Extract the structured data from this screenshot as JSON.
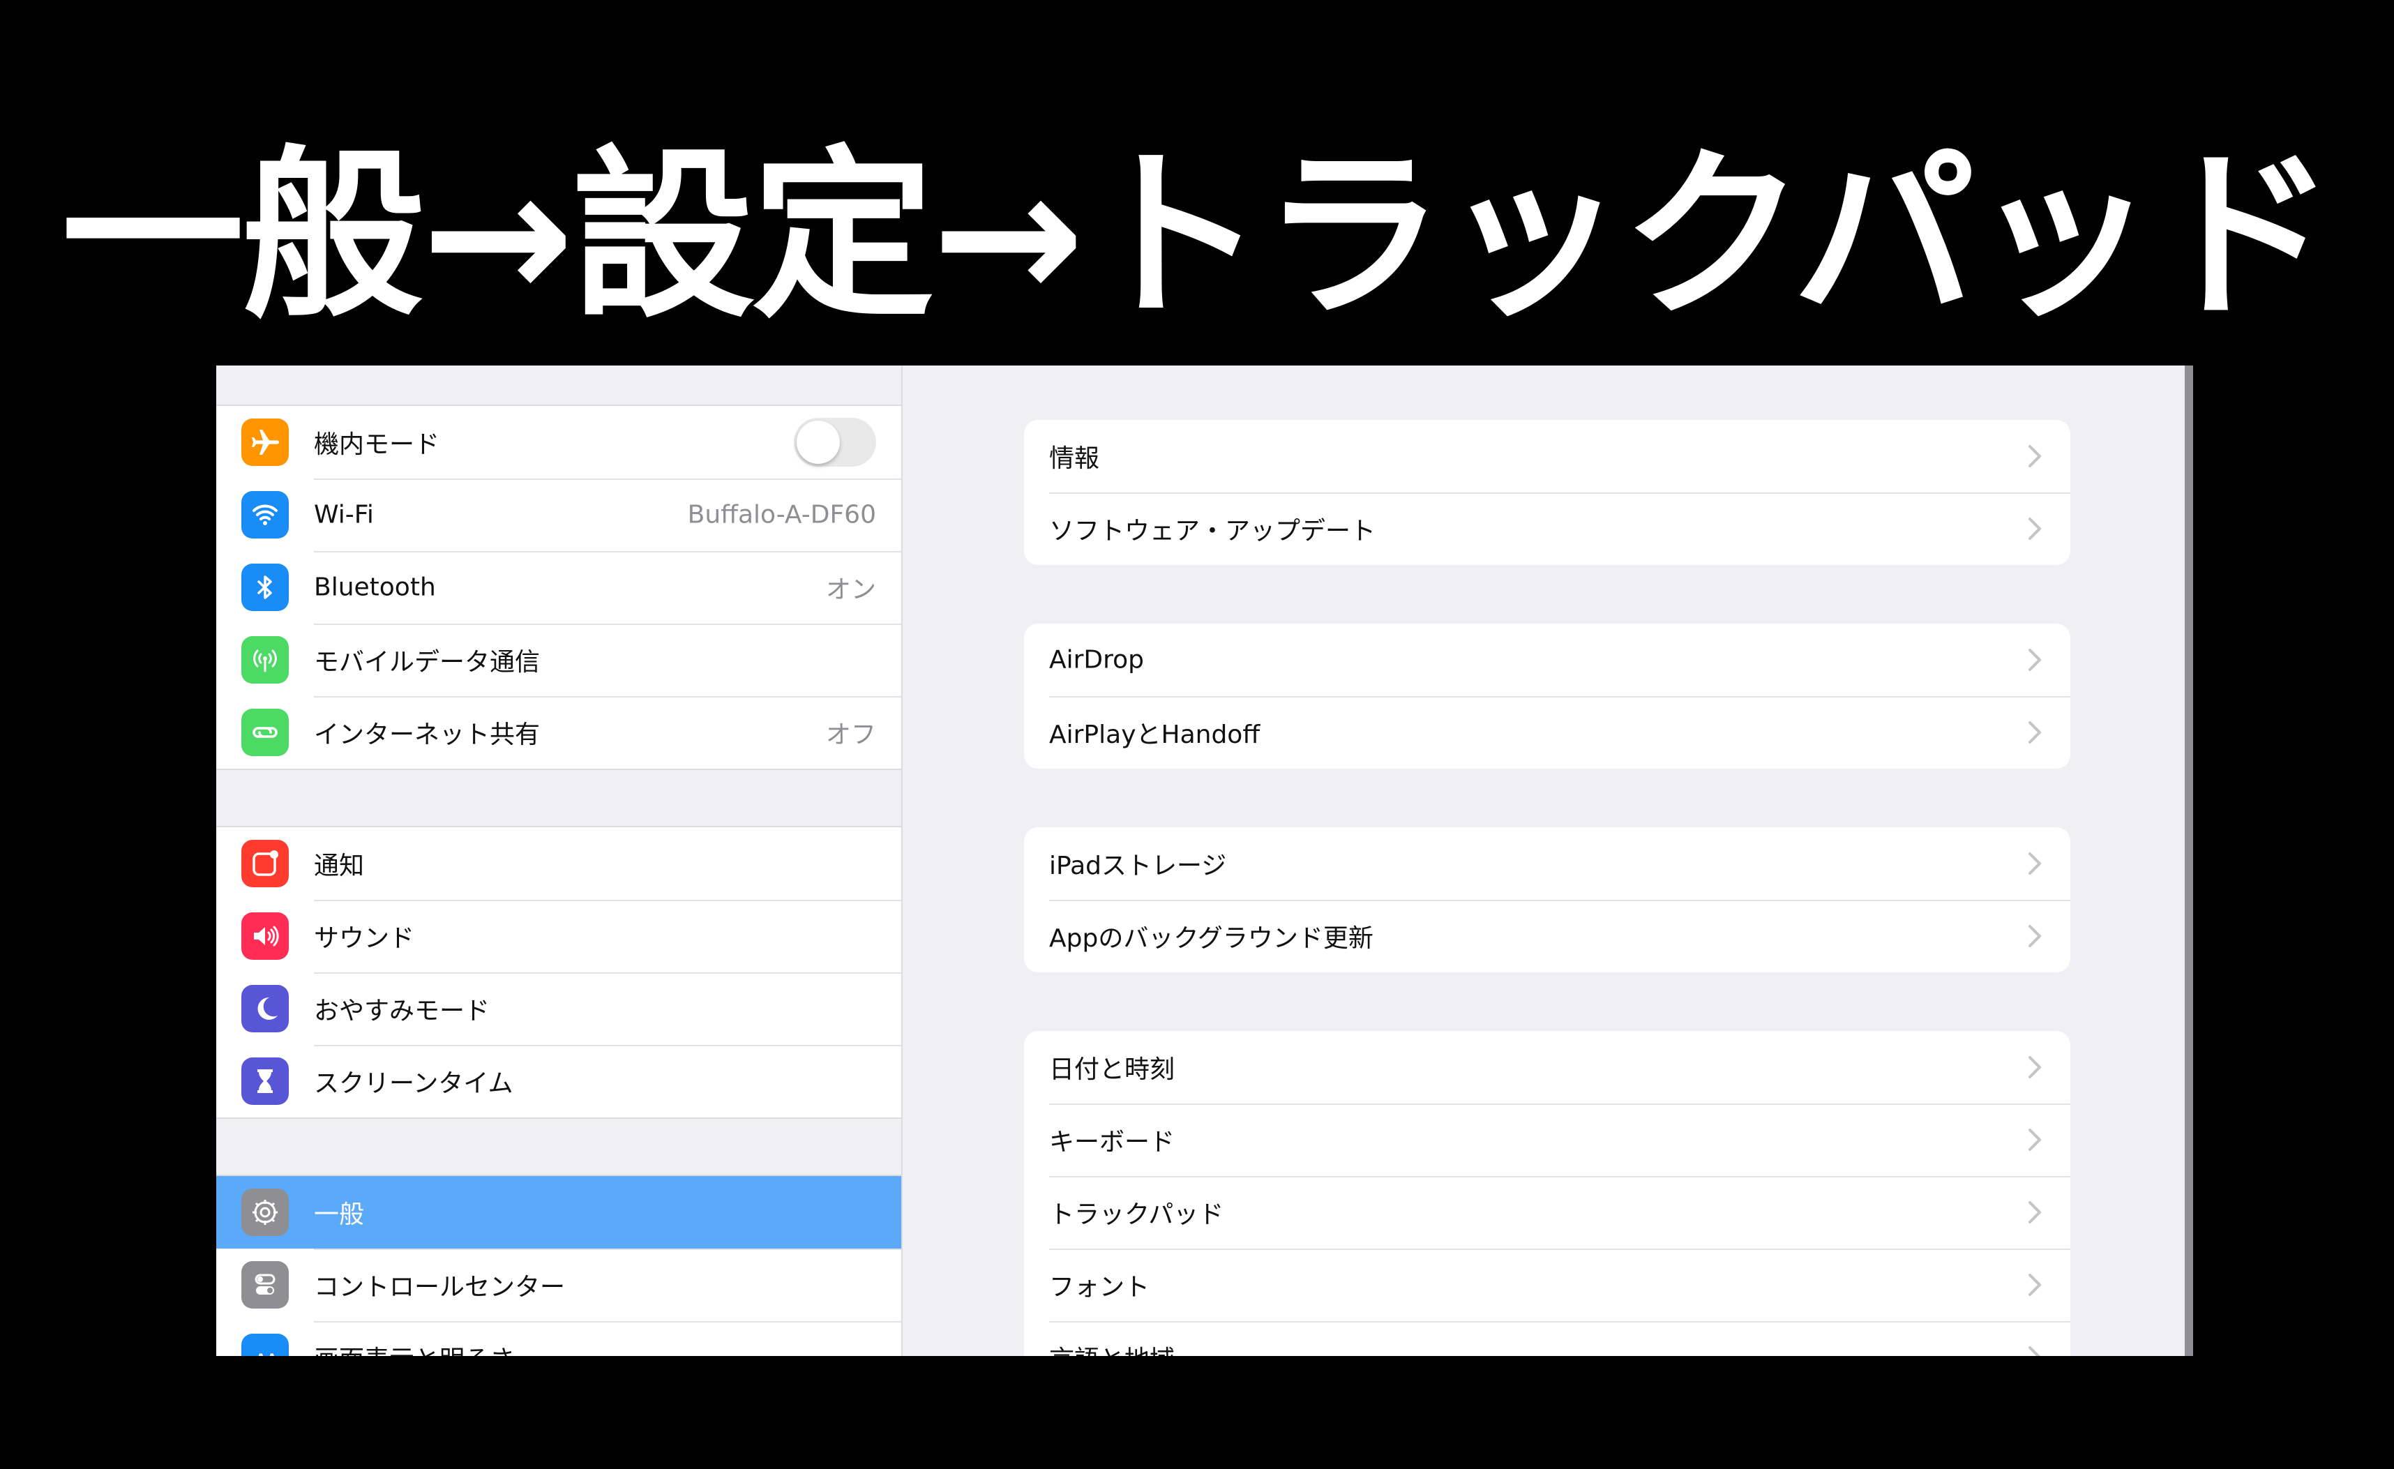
{
  "title": "一般→設定→トラックパッド",
  "colors": {
    "selected": "#5ba9f9",
    "background": "#efeff4"
  },
  "sidebar": {
    "groups": [
      {
        "items": [
          {
            "label": "機内モード",
            "icon": "airplane-icon",
            "color": "#ff9500",
            "toggle": "off"
          },
          {
            "label": "Wi-Fi",
            "icon": "wifi-icon",
            "color": "#1a8cf5",
            "value": "Buffalo-A-DF60"
          },
          {
            "label": "Bluetooth",
            "icon": "bluetooth-icon",
            "color": "#1a8cf5",
            "value": "オン"
          },
          {
            "label": "モバイルデータ通信",
            "icon": "antenna-icon",
            "color": "#4cd964"
          },
          {
            "label": "インターネット共有",
            "icon": "hotspot-icon",
            "color": "#4cd964",
            "value": "オフ"
          }
        ]
      },
      {
        "items": [
          {
            "label": "通知",
            "icon": "notifications-icon",
            "color": "#ff3b30"
          },
          {
            "label": "サウンド",
            "icon": "speaker-icon",
            "color": "#ff2d55"
          },
          {
            "label": "おやすみモード",
            "icon": "moon-icon",
            "color": "#5856d6"
          },
          {
            "label": "スクリーンタイム",
            "icon": "hourglass-icon",
            "color": "#5856d6"
          }
        ]
      },
      {
        "items": [
          {
            "label": "一般",
            "icon": "gear-icon",
            "color": "#8e8e93",
            "selected": true
          },
          {
            "label": "コントロールセンター",
            "icon": "switches-icon",
            "color": "#8e8e93"
          },
          {
            "label": "画面表示と明るさ",
            "icon": "display-icon",
            "color": "#1a8cf5"
          }
        ]
      }
    ]
  },
  "detail": {
    "groups": [
      {
        "items": [
          "情報",
          "ソフトウェア・アップデート"
        ]
      },
      {
        "items": [
          "AirDrop",
          "AirPlayとHandoff"
        ]
      },
      {
        "items": [
          "iPadストレージ",
          "Appのバックグラウンド更新"
        ]
      },
      {
        "items": [
          "日付と時刻",
          "キーボード",
          "トラックパッド",
          "フォント",
          "言語と地域"
        ]
      }
    ]
  }
}
